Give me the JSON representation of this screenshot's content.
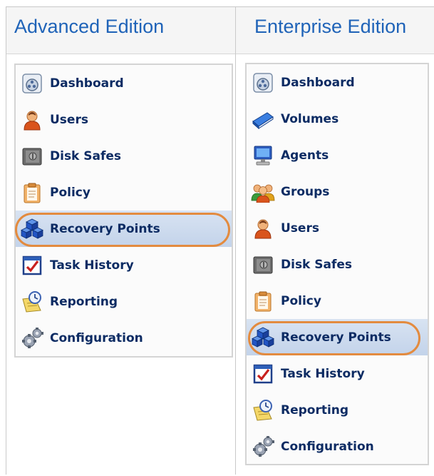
{
  "columns": [
    {
      "title": "Advanced Edition",
      "items": [
        {
          "label": "Dashboard",
          "icon": "dashboard-icon"
        },
        {
          "label": "Users",
          "icon": "user-icon"
        },
        {
          "label": "Disk Safes",
          "icon": "disk-safe-icon"
        },
        {
          "label": "Policy",
          "icon": "policy-clipboard-icon"
        },
        {
          "label": "Recovery Points",
          "icon": "recovery-points-cubes-icon",
          "selected": true
        },
        {
          "label": "Task History",
          "icon": "task-history-icon"
        },
        {
          "label": "Reporting",
          "icon": "reporting-clock-icon"
        },
        {
          "label": "Configuration",
          "icon": "configuration-gears-icon"
        }
      ]
    },
    {
      "title": "Enterprise Edition",
      "items": [
        {
          "label": "Dashboard",
          "icon": "dashboard-icon"
        },
        {
          "label": "Volumes",
          "icon": "volumes-book-icon"
        },
        {
          "label": "Agents",
          "icon": "agents-computer-icon"
        },
        {
          "label": "Groups",
          "icon": "groups-users-icon"
        },
        {
          "label": "Users",
          "icon": "user-icon"
        },
        {
          "label": "Disk Safes",
          "icon": "disk-safe-icon"
        },
        {
          "label": "Policy",
          "icon": "policy-clipboard-icon"
        },
        {
          "label": "Recovery Points",
          "icon": "recovery-points-cubes-icon",
          "selected": true
        },
        {
          "label": "Task History",
          "icon": "task-history-icon"
        },
        {
          "label": "Reporting",
          "icon": "reporting-clock-icon"
        },
        {
          "label": "Configuration",
          "icon": "configuration-gears-icon"
        }
      ]
    }
  ],
  "colors": {
    "title": "#1f63b8",
    "label": "#0c2b63",
    "highlight_ring": "#e38b3f",
    "selected_bg": "#c9d8ee"
  }
}
